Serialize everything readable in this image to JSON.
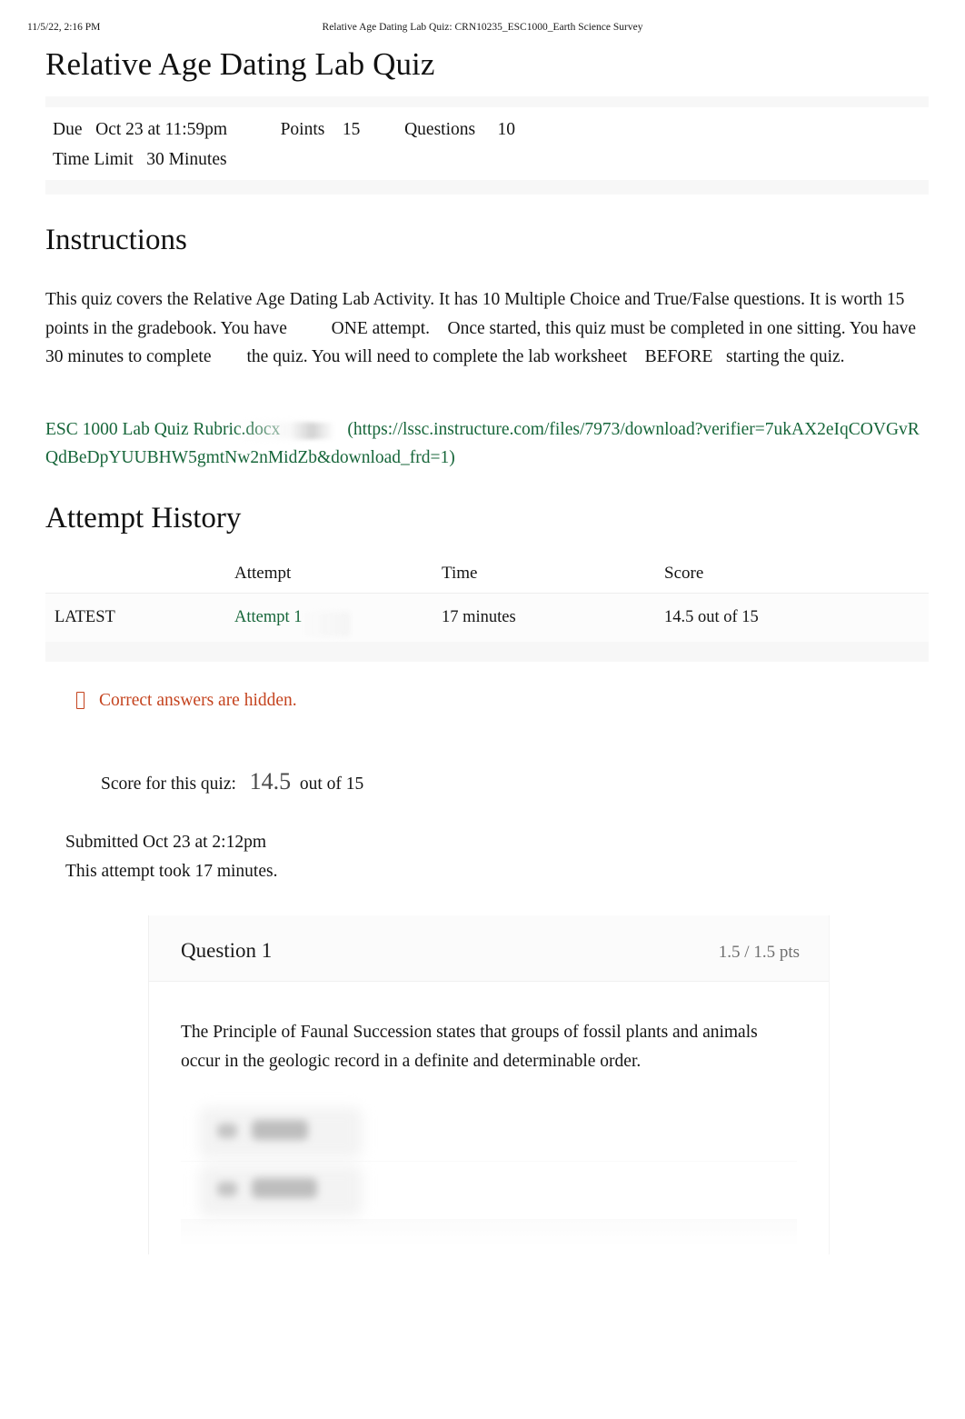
{
  "print_header": {
    "date": "11/5/22, 2:16 PM",
    "title": "Relative Age Dating Lab Quiz: CRN10235_ESC1000_Earth Science Survey"
  },
  "quiz": {
    "title": "Relative Age Dating Lab Quiz",
    "meta_line_1": "Due   Oct 23 at 11:59pm            Points    15          Questions     10",
    "meta_line_2": "Time Limit   30 Minutes",
    "due_label": "Due",
    "due_value": "Oct 23 at 11:59pm",
    "points_label": "Points",
    "points_value": "15",
    "questions_label": "Questions",
    "questions_value": "10",
    "time_limit_label": "Time Limit",
    "time_limit_value": "30 Minutes"
  },
  "instructions": {
    "heading": "Instructions",
    "body": "This quiz covers the Relative Age Dating Lab Activity. It has 10 Multiple Choice and True/False questions. It is worth 15 points in the gradebook. You have          ONE attempt.    Once started, this quiz must be completed in one sitting. You have        30 minutes to complete        the quiz. You will need to complete the lab worksheet    BEFORE   starting the quiz."
  },
  "attachment": {
    "name": "ESC 1000 Lab Quiz Rubric.docx",
    "url_text": "(https://lssc.instructure.com/files/7973/download?verifier=7ukAX2eIqCOVGvRQdBeDpYUUBHW5gmtNw2nMidZb&download_frd=1)"
  },
  "attempt_history": {
    "heading": "Attempt History",
    "columns": [
      "",
      "Attempt",
      "Time",
      "Score"
    ],
    "rows": [
      {
        "kept": "LATEST",
        "attempt": "Attempt 1",
        "time": "17 minutes",
        "score": "14.5 out of 15"
      }
    ]
  },
  "results": {
    "hidden_notice": "Correct answers are hidden.",
    "hidden_notice_icon": "missing-glyph-box-icon",
    "score_label": "Score for this quiz:",
    "score_value": "14.5",
    "score_suffix": "out of 15",
    "submitted": "Submitted Oct 23 at 2:12pm",
    "duration": "This attempt took 17 minutes."
  },
  "question": {
    "name": "Question 1",
    "points": "1.5 / 1.5 pts",
    "text": "The Principle of Faunal Succession states that groups of fossil plants and animals occur in the geologic record in a definite and determinable order.",
    "answers_redacted": true
  },
  "colors": {
    "link_green": "#17663a",
    "warning_orange": "#c4431e",
    "muted_gray": "#6f6f6f",
    "band_gray": "#f7f7f7"
  }
}
